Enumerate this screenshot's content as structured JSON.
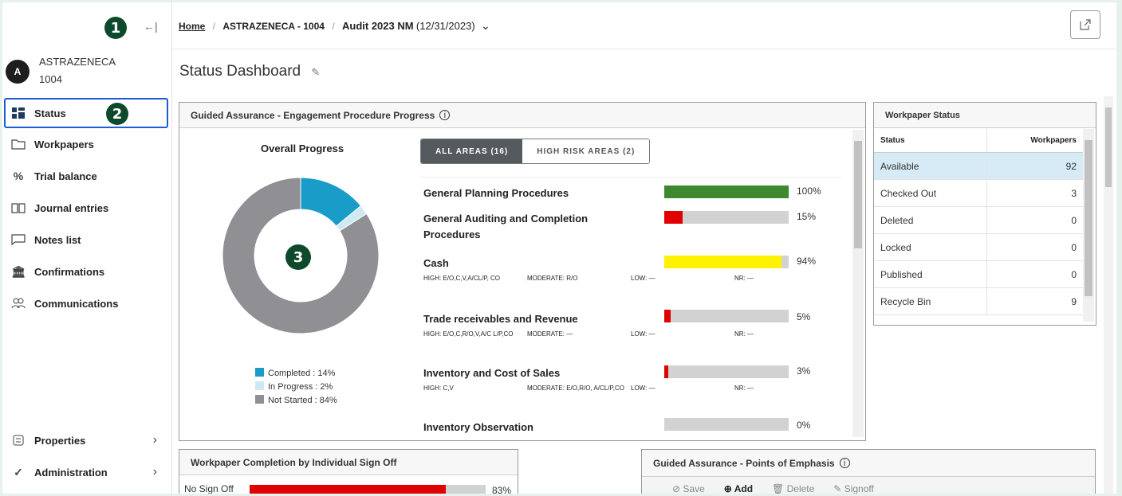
{
  "sidebar": {
    "collapse_icon": "←|",
    "client_initial": "A",
    "client_name": "ASTRAZENECA",
    "client_id": "1004",
    "items": [
      {
        "label": "Status",
        "icon": "dashboard-icon"
      },
      {
        "label": "Workpapers",
        "icon": "folder-icon"
      },
      {
        "label": "Trial balance",
        "icon": "percent-icon"
      },
      {
        "label": "Journal entries",
        "icon": "book-icon"
      },
      {
        "label": "Notes list",
        "icon": "note-icon"
      },
      {
        "label": "Confirmations",
        "icon": "bank-icon"
      },
      {
        "label": "Communications",
        "icon": "users-icon"
      }
    ],
    "bottom_items": [
      {
        "label": "Properties",
        "icon": "properties-icon"
      },
      {
        "label": "Administration",
        "icon": "check-icon"
      }
    ]
  },
  "badges": [
    "1",
    "2",
    "3"
  ],
  "breadcrumb": {
    "home": "Home",
    "client": "ASTRAZENECA - 1004",
    "audit": "Audit 2023 NM",
    "audit_date": "(12/31/2023)",
    "dropdown": "⌄"
  },
  "page_title": "Status Dashboard",
  "progress_panel": {
    "title": "Guided Assurance - Engagement Procedure Progress",
    "overall_title": "Overall Progress",
    "legend": [
      {
        "label": "Completed : 14%",
        "color": "#1a9cc8"
      },
      {
        "label": "In Progress : 2%",
        "color": "#cfe9f3"
      },
      {
        "label": "Not Started : 84%",
        "color": "#8f8f94"
      }
    ],
    "tabs": [
      "ALL AREAS (16)",
      "HIGH RISK AREAS (2)"
    ],
    "areas": [
      {
        "name": "General Planning Procedures",
        "pct": "100%",
        "fill": 1.0,
        "color": "#3d8a2e"
      },
      {
        "name": "General Auditing and Completion Procedures",
        "pct": "15%",
        "fill": 0.15,
        "color": "#e00000"
      },
      {
        "name": "Cash",
        "pct": "94%",
        "fill": 0.94,
        "color": "#fff200",
        "risk": {
          "high": "HIGH: E/O,C,V,A/CL/P, CO",
          "moderate": "MODERATE: R/O",
          "low": "LOW: —",
          "nr": "NR: —"
        }
      },
      {
        "name": "Trade receivables and Revenue",
        "pct": "5%",
        "fill": 0.05,
        "color": "#e00000",
        "risk": {
          "high": "HIGH: E/O,C,R/O,V,A/C L/P,CO",
          "moderate": "MODERATE: —",
          "low": "LOW: —",
          "nr": "NR: —"
        }
      },
      {
        "name": "Inventory and Cost of Sales",
        "pct": "3%",
        "fill": 0.03,
        "color": "#e00000",
        "risk": {
          "high": "HIGH: C,V",
          "moderate": "MODERATE: E/O,R/O, A/CL/P,CO",
          "low": "LOW: —",
          "nr": "NR: —"
        }
      },
      {
        "name": "Inventory Observation",
        "pct": "0%",
        "fill": 0.0,
        "color": "#e00000"
      }
    ],
    "donut": {
      "completed": 14,
      "in_progress": 2,
      "not_started": 84
    }
  },
  "workpaper_status": {
    "title": "Workpaper Status",
    "columns": [
      "Status",
      "Workpapers"
    ],
    "rows": [
      {
        "status": "Available",
        "count": "92"
      },
      {
        "status": "Checked Out",
        "count": "3"
      },
      {
        "status": "Deleted",
        "count": "0"
      },
      {
        "status": "Locked",
        "count": "0"
      },
      {
        "status": "Published",
        "count": "0"
      },
      {
        "status": "Recycle Bin",
        "count": "9"
      }
    ]
  },
  "signoff_panel": {
    "title": "Workpaper Completion by Individual Sign Off",
    "rows": [
      {
        "label": "No Sign Off",
        "pct": "83%",
        "fill": 0.83
      }
    ]
  },
  "emphasis_panel": {
    "title": "Guided Assurance - Points of Emphasis",
    "toolbar": [
      "Save",
      "Add",
      "Delete",
      "Signoff"
    ]
  }
}
